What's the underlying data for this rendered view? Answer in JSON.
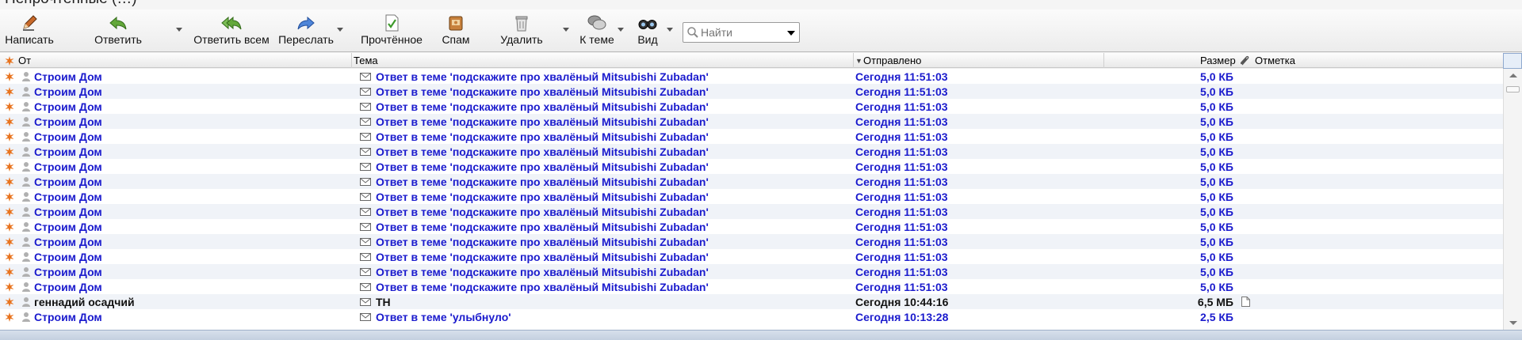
{
  "window": {
    "title": "Непрочтённые  (…)"
  },
  "toolbar": {
    "compose": "Написать",
    "reply": "Ответить",
    "reply_all": "Ответить всем",
    "forward": "Переслать",
    "mark_read": "Прочтённое",
    "spam": "Спам",
    "delete": "Удалить",
    "to_thread": "К теме",
    "view": "Вид"
  },
  "search": {
    "placeholder": "Найти"
  },
  "columns": {
    "from": "От",
    "subject": "Тема",
    "sent": "Отправлено",
    "size": "Размер",
    "mark": "Отметка"
  },
  "messages": [
    {
      "from": "Строим Дом",
      "subject": "Ответ в теме 'подскажите про хвалёный Mitsubishi Zubadan'",
      "sent": "Сегодня 11:51:03",
      "size": "5,0 КБ"
    },
    {
      "from": "Строим Дом",
      "subject": "Ответ в теме 'подскажите про хвалёный Mitsubishi Zubadan'",
      "sent": "Сегодня 11:51:03",
      "size": "5,0 КБ"
    },
    {
      "from": "Строим Дом",
      "subject": "Ответ в теме 'подскажите про хвалёный Mitsubishi Zubadan'",
      "sent": "Сегодня 11:51:03",
      "size": "5,0 КБ"
    },
    {
      "from": "Строим Дом",
      "subject": "Ответ в теме 'подскажите про хвалёный Mitsubishi Zubadan'",
      "sent": "Сегодня 11:51:03",
      "size": "5,0 КБ"
    },
    {
      "from": "Строим Дом",
      "subject": "Ответ в теме 'подскажите про хвалёный Mitsubishi Zubadan'",
      "sent": "Сегодня 11:51:03",
      "size": "5,0 КБ"
    },
    {
      "from": "Строим Дом",
      "subject": "Ответ в теме 'подскажите про хвалёный Mitsubishi Zubadan'",
      "sent": "Сегодня 11:51:03",
      "size": "5,0 КБ"
    },
    {
      "from": "Строим Дом",
      "subject": "Ответ в теме 'подскажите про хвалёный Mitsubishi Zubadan'",
      "sent": "Сегодня 11:51:03",
      "size": "5,0 КБ"
    },
    {
      "from": "Строим Дом",
      "subject": "Ответ в теме 'подскажите про хвалёный Mitsubishi Zubadan'",
      "sent": "Сегодня 11:51:03",
      "size": "5,0 КБ"
    },
    {
      "from": "Строим Дом",
      "subject": "Ответ в теме 'подскажите про хвалёный Mitsubishi Zubadan'",
      "sent": "Сегодня 11:51:03",
      "size": "5,0 КБ"
    },
    {
      "from": "Строим Дом",
      "subject": "Ответ в теме 'подскажите про хвалёный Mitsubishi Zubadan'",
      "sent": "Сегодня 11:51:03",
      "size": "5,0 КБ"
    },
    {
      "from": "Строим Дом",
      "subject": "Ответ в теме 'подскажите про хвалёный Mitsubishi Zubadan'",
      "sent": "Сегодня 11:51:03",
      "size": "5,0 КБ"
    },
    {
      "from": "Строим Дом",
      "subject": "Ответ в теме 'подскажите про хвалёный Mitsubishi Zubadan'",
      "sent": "Сегодня 11:51:03",
      "size": "5,0 КБ"
    },
    {
      "from": "Строим Дом",
      "subject": "Ответ в теме 'подскажите про хвалёный Mitsubishi Zubadan'",
      "sent": "Сегодня 11:51:03",
      "size": "5,0 КБ"
    },
    {
      "from": "Строим Дом",
      "subject": "Ответ в теме 'подскажите про хвалёный Mitsubishi Zubadan'",
      "sent": "Сегодня 11:51:03",
      "size": "5,0 КБ"
    },
    {
      "from": "Строим Дом",
      "subject": "Ответ в теме 'подскажите про хвалёный Mitsubishi Zubadan'",
      "sent": "Сегодня 11:51:03",
      "size": "5,0 КБ"
    },
    {
      "from": "геннадий осадчий",
      "subject": "TH",
      "sent": "Сегодня 10:44:16",
      "size": "6,5 МБ",
      "read": true,
      "attachment": true
    },
    {
      "from": "Строим Дом",
      "subject": "Ответ в теме 'улыбнуло'",
      "sent": "Сегодня 10:13:28",
      "size": "2,5 КБ"
    }
  ],
  "colors": {
    "unread_text": "#1a1acd",
    "read_text": "#111111",
    "star": "#e8731e",
    "row_alt": "#f0f3f8"
  },
  "icons": {
    "compose": "pencil-icon",
    "reply": "reply-arrow-icon",
    "reply_all": "reply-all-icon",
    "forward": "forward-arrow-icon",
    "mark_read": "document-check-icon",
    "spam": "spam-box-icon",
    "delete": "trash-icon",
    "to_thread": "chat-bubbles-icon",
    "view": "binoculars-icon",
    "search": "magnifier-icon",
    "row_flag": "star-burst-icon",
    "row_sender": "person-icon",
    "row_subject": "envelope-icon",
    "column_attachment": "paperclip-icon",
    "row_attachment": "file-icon"
  }
}
